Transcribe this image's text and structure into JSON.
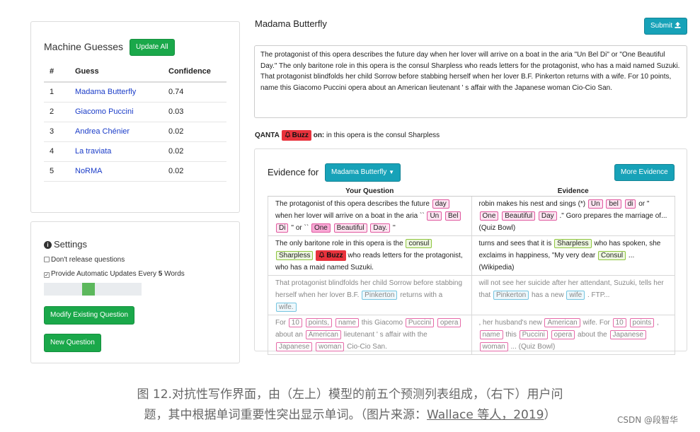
{
  "guesses": {
    "title": "Machine Guesses",
    "update_label": "Update All",
    "headers": [
      "#",
      "Guess",
      "Confidence"
    ],
    "rows": [
      {
        "n": "1",
        "guess": "Madama Butterfly",
        "conf": "0.74"
      },
      {
        "n": "2",
        "guess": "Giacomo Puccini",
        "conf": "0.03"
      },
      {
        "n": "3",
        "guess": "Andrea Chénier",
        "conf": "0.02"
      },
      {
        "n": "4",
        "guess": "La traviata",
        "conf": "0.02"
      },
      {
        "n": "5",
        "guess": "NoRMA",
        "conf": "0.02"
      }
    ]
  },
  "settings": {
    "title": "Settings",
    "dont_release": "Don't release questions",
    "auto_update_prefix": "Provide Automatic Updates Every ",
    "auto_update_n": "5",
    "auto_update_suffix": " Words",
    "slider_value": 0.45,
    "modify_label": "Modify Existing Question",
    "new_label": "New Question"
  },
  "question": {
    "title": "Madama Butterfly",
    "submit_label": "Submit",
    "text": "The protagonist of this opera describes the future day when her lover will arrive on a boat in the aria \"Un Bel Di\" or \"One Beautiful Day.\" The only baritone role in this opera is the consul Sharpless who reads letters for the protagonist, who has a maid named Suzuki. That protagonist blindfolds her child Sorrow before stabbing herself when her lover B.F. Pinkerton returns with a wife. For 10 points, name this Giacomo Puccini opera about an American lieutenant ' s affair with the Japanese woman Cio-Cio San."
  },
  "qanta": {
    "name": "QANTA",
    "buzz": "Buzz",
    "on": "on:",
    "context": " in this opera is the consul Sharpless"
  },
  "evidence": {
    "label": "Evidence for",
    "dropdown": "Madama Butterfly",
    "more_label": "More Evidence",
    "col_question": "Your Question",
    "col_evidence": "Evidence",
    "rows": [
      {
        "q": [
          [
            "t",
            "The protagonist of this opera describes the future "
          ],
          [
            "pk",
            "day"
          ],
          [
            "t",
            " when her lover will arrive on a boat in the aria `` "
          ],
          [
            "pk",
            "Un"
          ],
          [
            "t",
            " "
          ],
          [
            "pk",
            "Bel"
          ],
          [
            "t",
            " "
          ],
          [
            "pk",
            "Di"
          ],
          [
            "t",
            " '' or `` "
          ],
          [
            "pk2",
            "One"
          ],
          [
            "t",
            " "
          ],
          [
            "pk",
            "Beautiful"
          ],
          [
            "t",
            " "
          ],
          [
            "pk",
            "Day."
          ],
          [
            "t",
            " ''"
          ]
        ],
        "e": [
          [
            "t",
            "robin makes his nest and sings (*) "
          ],
          [
            "pk",
            "Un"
          ],
          [
            "t",
            " "
          ],
          [
            "pk",
            "bel"
          ],
          [
            "t",
            " "
          ],
          [
            "pk",
            "di"
          ],
          [
            "t",
            " or \" "
          ],
          [
            "pk",
            "One"
          ],
          [
            "t",
            " "
          ],
          [
            "pk",
            "Beautiful"
          ],
          [
            "t",
            " "
          ],
          [
            "pk",
            "Day"
          ],
          [
            "t",
            " .\" Goro prepares the marriage of... (Quiz Bowl)"
          ]
        ],
        "faded": false
      },
      {
        "q": [
          [
            "t",
            "The only baritone role in this opera is the "
          ],
          [
            "gr",
            "consul"
          ],
          [
            "t",
            " "
          ],
          [
            "gr",
            "Sharpless"
          ],
          [
            "t",
            " "
          ],
          [
            "buzz",
            "Buzz"
          ],
          [
            "t",
            " who reads letters for the protagonist, who has a maid named Suzuki."
          ]
        ],
        "e": [
          [
            "t",
            "turns and sees that it is "
          ],
          [
            "gr",
            "Sharpless"
          ],
          [
            "t",
            " who has spoken, she exclaims in happiness, \"My very dear "
          ],
          [
            "gr",
            "Consul"
          ],
          [
            "t",
            " ... (Wikipedia)"
          ]
        ],
        "faded": false
      },
      {
        "q": [
          [
            "t",
            "That protagonist blindfolds her child Sorrow before stabbing herself when her lover B.F. "
          ],
          [
            "bl",
            "Pinkerton"
          ],
          [
            "t",
            " returns with a "
          ],
          [
            "bl",
            "wife."
          ]
        ],
        "e": [
          [
            "t",
            "will not see her suicide after her attendant, Suzuki, tells her that "
          ],
          [
            "bl",
            "Pinkerton"
          ],
          [
            "t",
            " has a new "
          ],
          [
            "bl",
            "wife"
          ],
          [
            "t",
            " . FTP..."
          ]
        ],
        "faded": true
      },
      {
        "q": [
          [
            "t",
            "For "
          ],
          [
            "pko",
            "10"
          ],
          [
            "t",
            " "
          ],
          [
            "pko",
            "points,"
          ],
          [
            "t",
            " "
          ],
          [
            "pko",
            "name"
          ],
          [
            "t",
            " this Giacomo "
          ],
          [
            "pko",
            "Puccini"
          ],
          [
            "t",
            " "
          ],
          [
            "pko",
            "opera"
          ],
          [
            "t",
            " about an "
          ],
          [
            "pko",
            "American"
          ],
          [
            "t",
            " lieutenant ' s affair with the "
          ],
          [
            "pko",
            "Japanese"
          ],
          [
            "t",
            " "
          ],
          [
            "pko",
            "woman"
          ],
          [
            "t",
            " Cio-Cio San."
          ]
        ],
        "e": [
          [
            "t",
            ", her husband's new "
          ],
          [
            "pko",
            "American"
          ],
          [
            "t",
            " wife. For "
          ],
          [
            "pko",
            "10"
          ],
          [
            "t",
            " "
          ],
          [
            "pko",
            "points"
          ],
          [
            "t",
            " , "
          ],
          [
            "pko",
            "name"
          ],
          [
            "t",
            " this "
          ],
          [
            "pko",
            "Puccini"
          ],
          [
            "t",
            " "
          ],
          [
            "pko",
            "opera"
          ],
          [
            "t",
            " about the "
          ],
          [
            "pko",
            "Japanese"
          ],
          [
            "t",
            " "
          ],
          [
            "pko",
            "woman"
          ],
          [
            "t",
            " ... (Quiz Bowl)"
          ]
        ],
        "faded": true
      }
    ]
  },
  "caption": {
    "line1": "图 12.对抗性写作界面，由（左上）模型的前五个预测列表组成，（右下）用户问",
    "line2_prefix": "题，其中根据单词重要性突出显示单词。（图片来源：",
    "line2_source": "Wallace 等人，2019",
    "line2_suffix": "）",
    "watermark": "CSDN @段智华"
  }
}
